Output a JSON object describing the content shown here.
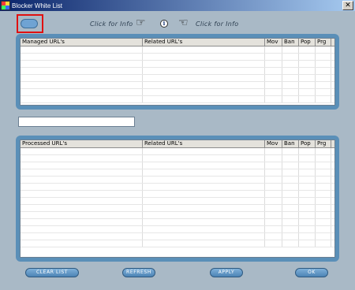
{
  "window": {
    "title": "Blocker White List",
    "close_glyph": "✕"
  },
  "top": {
    "left_info": "Click for Info",
    "right_info": "Click for Info",
    "info_glyph": "i"
  },
  "managed_table": {
    "columns": [
      "Managed URL's",
      "Related URL's",
      "Mov",
      "Ban",
      "Pop",
      "Prg"
    ]
  },
  "processed_table": {
    "columns": [
      "Processed URL's",
      "Related URL's",
      "Mov",
      "Ban",
      "Pop",
      "Prg"
    ]
  },
  "url_input": {
    "value": ""
  },
  "buttons": {
    "clear": "CLEAR LIST",
    "refresh": "REFRESH",
    "apply": "APPLY",
    "ok": "OK"
  },
  "colors": {
    "panel": "#5a8fb8",
    "background": "#a9b9c6",
    "highlight": "#e01010"
  }
}
